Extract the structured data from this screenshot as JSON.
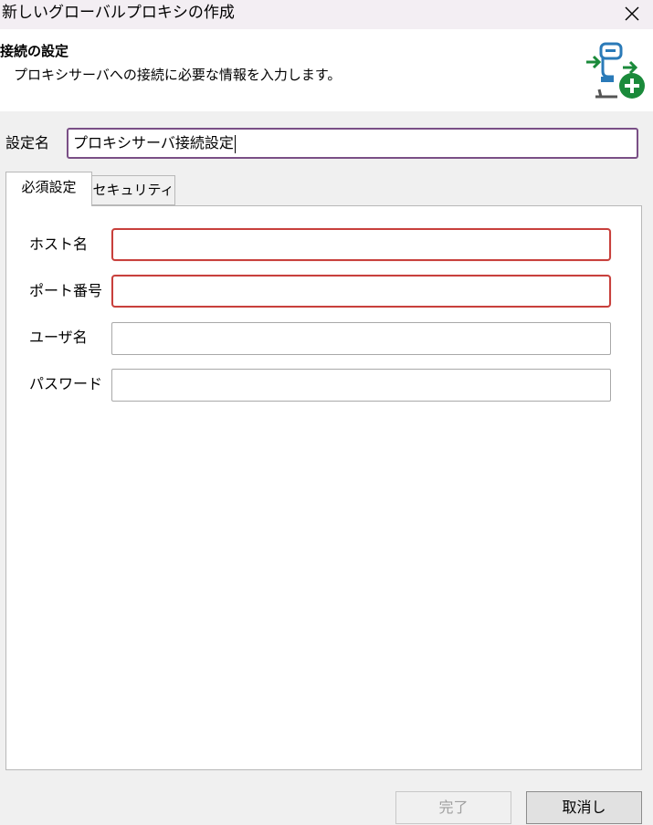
{
  "window": {
    "title": "新しいグローバルプロキシの作成",
    "close_icon": "close-icon"
  },
  "banner": {
    "heading": "接続の設定",
    "description": "プロキシサーバへの接続に必要な情報を入力します。",
    "logo_icon": "proxy-add-icon"
  },
  "name_field": {
    "label": "設定名",
    "value": "プロキシサーバ接続設定"
  },
  "tabs": [
    {
      "label": "必須設定",
      "active": true
    },
    {
      "label": "セキュリティ",
      "active": false
    }
  ],
  "fields": [
    {
      "label": "ホスト名",
      "value": "",
      "state": "error"
    },
    {
      "label": "ポート番号",
      "value": "",
      "state": "error"
    },
    {
      "label": "ユーザ名",
      "value": "",
      "state": "normal"
    },
    {
      "label": "パスワード",
      "value": "",
      "state": "normal"
    }
  ],
  "buttons": {
    "finish": {
      "label": "完了",
      "enabled": false
    },
    "cancel": {
      "label": "取消し",
      "enabled": true
    }
  },
  "colors": {
    "error_border": "#c8403c",
    "focus_border": "#7a4f86",
    "logo_green": "#1a8a3a",
    "logo_blue": "#2a7ab8"
  }
}
